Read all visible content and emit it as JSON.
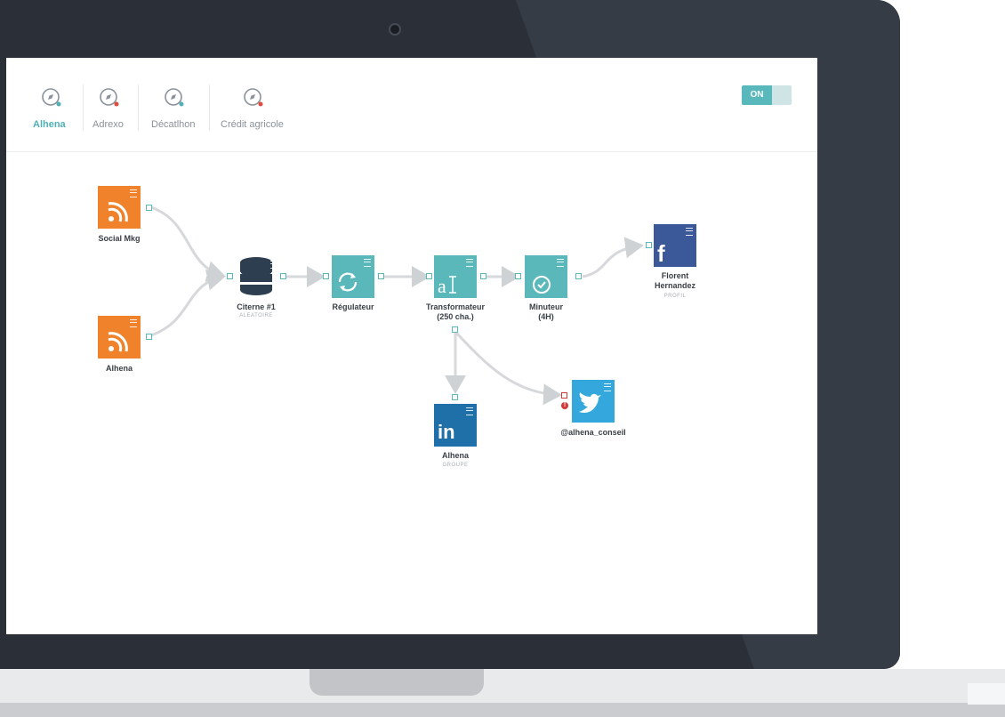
{
  "tabs": [
    {
      "label": "Alhena",
      "active": true,
      "dot_color": "#4fb1b5"
    },
    {
      "label": "Adrexo",
      "active": false,
      "dot_color": "#e24b3b"
    },
    {
      "label": "Décatlhon",
      "active": false,
      "dot_color": "#4fb1b5"
    },
    {
      "label": "Crédit agricole",
      "active": false,
      "dot_color": "#e24b3b"
    }
  ],
  "toggle": {
    "label": "ON",
    "state": "on"
  },
  "colors": {
    "rss": "#f0822b",
    "module": "#5bb8ba",
    "database": "#2d3e50",
    "facebook": "#3b5998",
    "linkedin": "#1f6fa8",
    "twitter": "#34a8dc",
    "accent": "#4fb1b5",
    "error": "#d23a3a"
  },
  "nodes": {
    "social_mkg": {
      "label": "Social Mkg",
      "icon": "rss-icon"
    },
    "alhena_rss": {
      "label": "Alhena",
      "icon": "rss-icon"
    },
    "citerne": {
      "label": "Citerne #1",
      "sub": "ALEATOIRE",
      "icon": "database-icon"
    },
    "regulateur": {
      "label": "Régulateur",
      "icon": "refresh-icon"
    },
    "transformateur": {
      "label_1": "Transformateur",
      "label_2": "(250 cha.)",
      "icon": "text-transform-icon"
    },
    "minuteur": {
      "label_1": "Minuteur",
      "label_2": "(4H)",
      "icon": "clock-icon"
    },
    "facebook": {
      "label_1": "Florent",
      "label_2": "Hernandez",
      "sub": "PROFIL",
      "icon": "facebook-icon",
      "glyph": "f"
    },
    "linkedin": {
      "label": "Alhena",
      "sub": "GROUPE",
      "icon": "linkedin-icon",
      "glyph": "in"
    },
    "twitter": {
      "label": "@alhena_conseil",
      "icon": "twitter-icon",
      "error_glyph": "!"
    }
  }
}
